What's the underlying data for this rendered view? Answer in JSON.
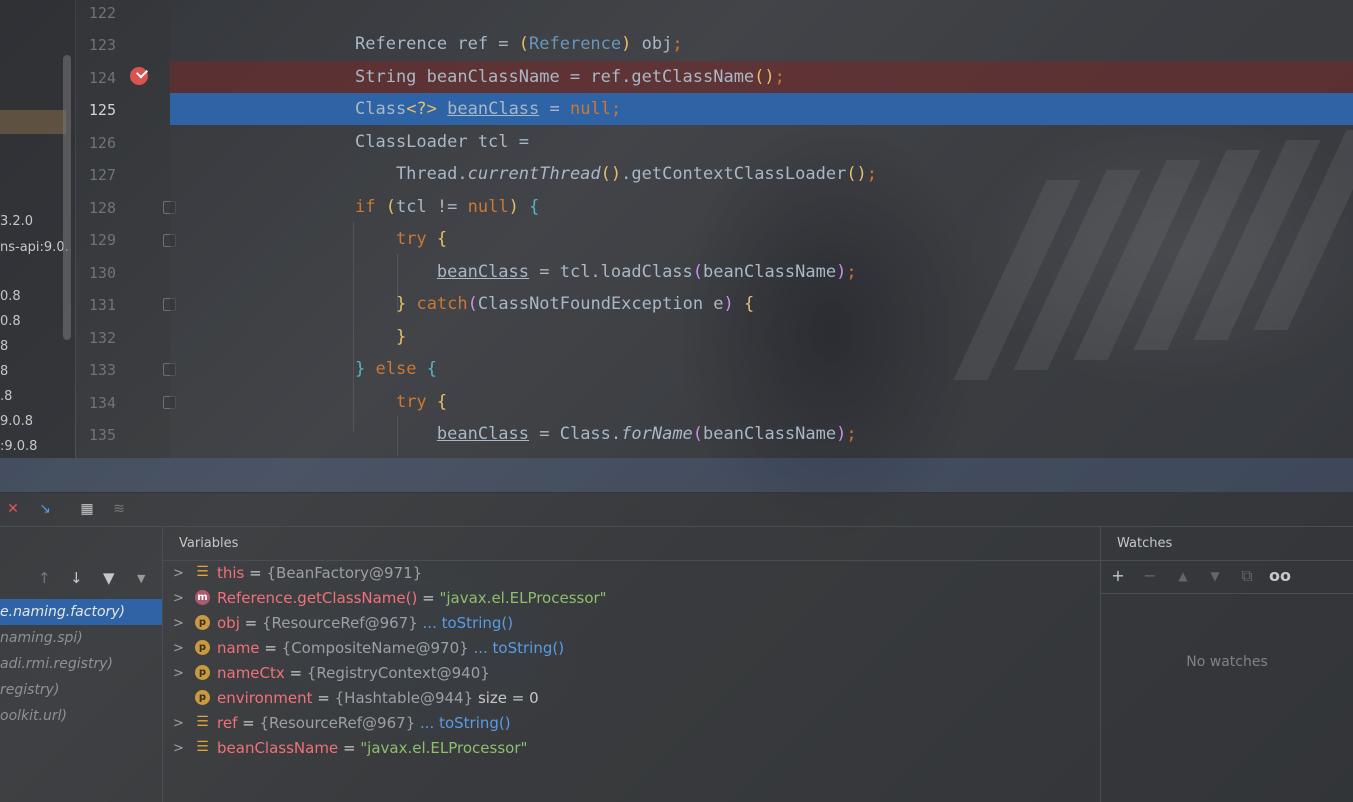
{
  "project": {
    "rows": [
      "3.2.0",
      "ns-api:9.0.",
      "0.8",
      "0.8",
      "8",
      "8",
      "9.0.8",
      ".8",
      ":9.0.8"
    ]
  },
  "editor": {
    "line_numbers": [
      "122",
      "123",
      "124",
      "125",
      "126",
      "127",
      "128",
      "129",
      "130",
      "131",
      "132",
      "133",
      "134",
      "135"
    ],
    "current_line": "125",
    "breakpoint_line": "124"
  },
  "toolbar": {
    "icons": [
      "stop-restore-icon",
      "step-into-icon",
      "evaluate-table-icon",
      "settings-table-icon"
    ]
  },
  "frames": {
    "items": [
      "e.naming.factory)",
      "naming.spi)",
      "adi.rmi.registry)",
      "registry)",
      "oolkit.url)"
    ],
    "selected_index": 0
  },
  "variables": {
    "title": "Variables",
    "rows": [
      {
        "icon": "list",
        "name": "this",
        "eq": " = ",
        "value": "{BeanFactory@971}",
        "link": "",
        "extra": ""
      },
      {
        "icon": "method",
        "name": "Reference.getClassName()",
        "eq": " = ",
        "value": "",
        "str": "\"javax.el.ELProcessor\"",
        "link": "",
        "extra": ""
      },
      {
        "icon": "p",
        "name": "obj",
        "eq": " = ",
        "value": "{ResourceRef@967}",
        "link": "... toString()",
        "extra": ""
      },
      {
        "icon": "p",
        "name": "name",
        "eq": " = ",
        "value": "{CompositeName@970}",
        "link": "... toString()",
        "extra": ""
      },
      {
        "icon": "p",
        "name": "nameCtx",
        "eq": " = ",
        "value": "{RegistryContext@940}",
        "link": "",
        "extra": ""
      },
      {
        "icon": "p",
        "name": "environment",
        "eq": " = ",
        "value": "{Hashtable@944}",
        "link": "",
        "extra": "size = 0"
      },
      {
        "icon": "list",
        "name": "ref",
        "eq": " = ",
        "value": "{ResourceRef@967}",
        "link": "... toString()",
        "extra": ""
      },
      {
        "icon": "list",
        "name": "beanClassName",
        "eq": " = ",
        "value": "",
        "str": "\"javax.el.ELProcessor\"",
        "link": "",
        "extra": ""
      }
    ]
  },
  "watches": {
    "title": "Watches",
    "empty_text": "No watches",
    "buttons": [
      "+",
      "−",
      "▲",
      "▼",
      "⧉",
      "oo"
    ]
  }
}
